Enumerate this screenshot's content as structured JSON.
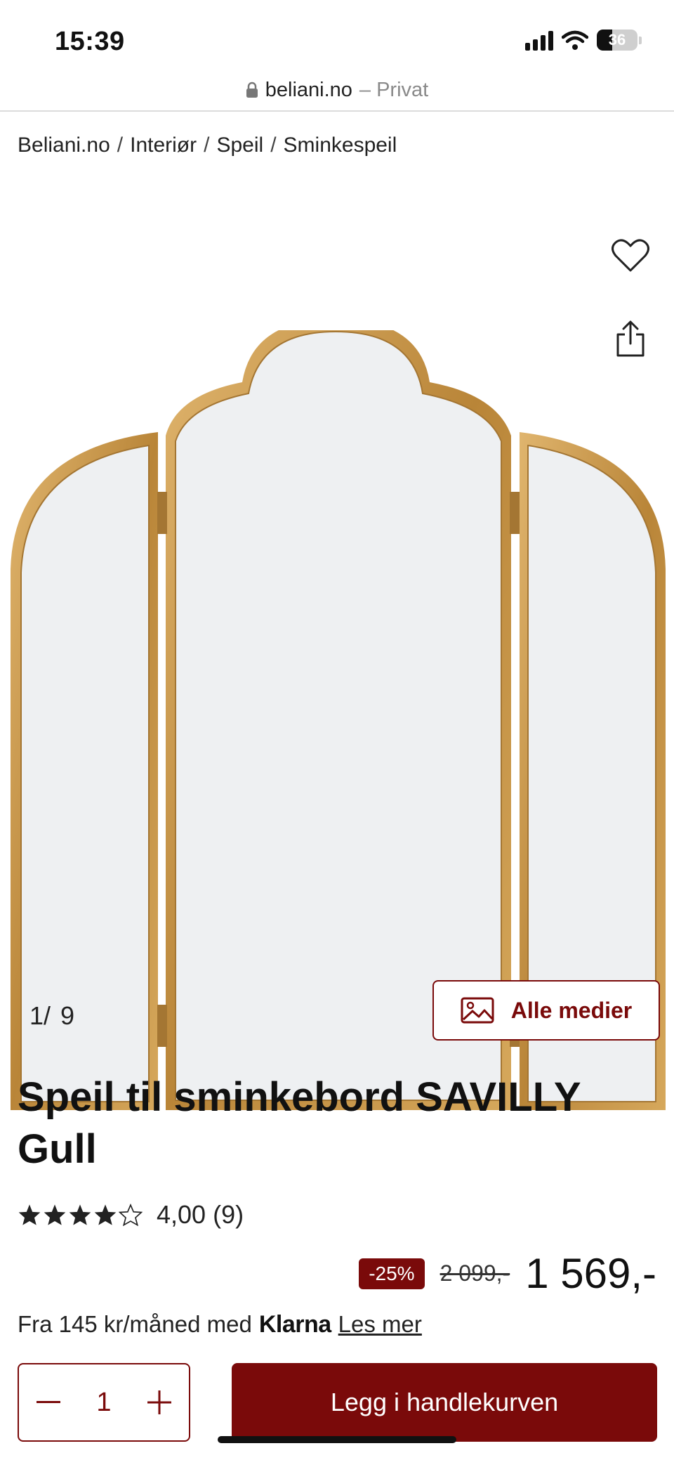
{
  "status_bar": {
    "time": "15:39",
    "battery": "36"
  },
  "url_bar": {
    "domain": "beliani.no",
    "suffix": "– Privat"
  },
  "breadcrumb": [
    "Beliani.no",
    "Interiør",
    "Speil",
    "Sminkespeil"
  ],
  "breadcrumb_separator": "/",
  "gallery": {
    "current": "1/",
    "total": "9",
    "all_media_label": "Alle medier"
  },
  "product": {
    "title": "Speil til sminkebord SAVILLY Gull",
    "rating_value": "4,00",
    "rating_count": "(9)",
    "stars_filled": 4,
    "stars_total": 5,
    "discount": "-25%",
    "old_price": "2 099,-",
    "price": "1 569,-"
  },
  "financing": {
    "text": "Fra 145 kr/måned med",
    "brand": "Klarna",
    "link": "Les mer"
  },
  "purchase": {
    "quantity": "1",
    "add_to_cart_label": "Legg i handlekurven"
  },
  "colors": {
    "accent": "#7a0a0a",
    "gold": "#c9974f",
    "mirror": "#eef0f2"
  },
  "icons": [
    "signal-icon",
    "wifi-icon",
    "battery-icon",
    "lock-icon",
    "heart-icon",
    "share-icon",
    "image-icon",
    "star-icon",
    "minus-icon",
    "plus-icon"
  ]
}
